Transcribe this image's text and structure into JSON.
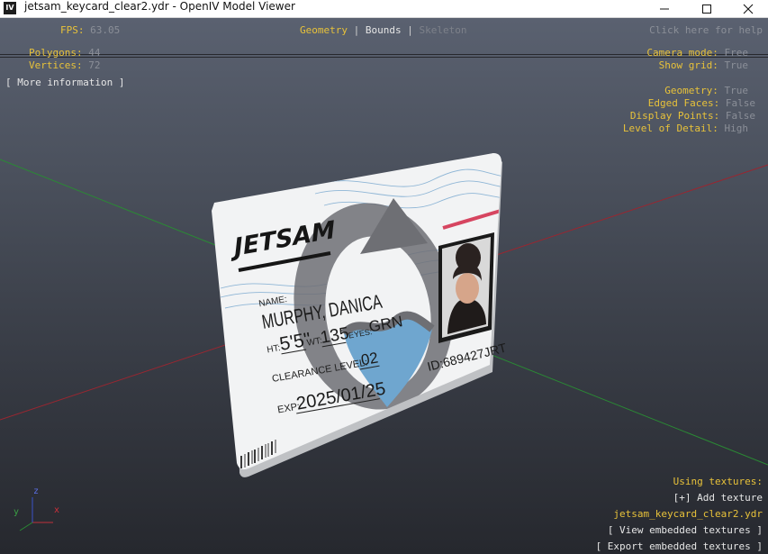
{
  "window": {
    "icon_text": "IV",
    "title": "jetsam_keycard_clear2.ydr - OpenIV Model Viewer"
  },
  "hud": {
    "fps_label": "FPS:",
    "fps_value": "63.05",
    "polygons_label": "Polygons:",
    "polygons_value": "44",
    "vertices_label": "Vertices:",
    "vertices_value": "72",
    "more_info": "[ More information ]",
    "tabs": [
      {
        "label": "Geometry",
        "state": "active"
      },
      {
        "label": "Bounds",
        "state": "normal"
      },
      {
        "label": "Skeleton",
        "state": "disabled"
      }
    ],
    "help": "Click here for help",
    "settings": [
      {
        "label": "Camera mode:",
        "value": "Free"
      },
      {
        "label": "Show grid:",
        "value": "True"
      },
      {
        "label": "Geometry:",
        "value": "True"
      },
      {
        "label": "Edged Faces:",
        "value": "False"
      },
      {
        "label": "Display Points:",
        "value": "False"
      },
      {
        "label": "Level of Detail:",
        "value": "High"
      }
    ],
    "textures": {
      "heading": "Using textures:",
      "add": "[+] Add texture",
      "file": "jetsam_keycard_clear2.ydr",
      "view": "[ View embedded textures ]",
      "export": "[ Export embedded textures ]"
    },
    "axes": {
      "x": "x",
      "y": "y",
      "z": "z"
    }
  },
  "card": {
    "brand": "JETSAM",
    "name_label": "NAME:",
    "name": "MURPHY, DANICA",
    "ht_label": "HT:",
    "ht": "5'5\"",
    "wt_label": "WT:",
    "wt": "135",
    "eyes_label": "EYES:",
    "eyes": "GRN",
    "clearance_label": "CLEARANCE LEVEL:",
    "clearance": "02",
    "exp_label": "EXP:",
    "exp": "2025/01/25",
    "id": "ID:689427JRT"
  },
  "colors": {
    "hud_accent": "#e8c23a",
    "grid_red": "#9a2630",
    "grid_green": "#2a8a34",
    "card_logo_gray": "#6e6f74",
    "card_logo_blue": "#6fa6cf",
    "card_stripe_red": "#d64560"
  }
}
